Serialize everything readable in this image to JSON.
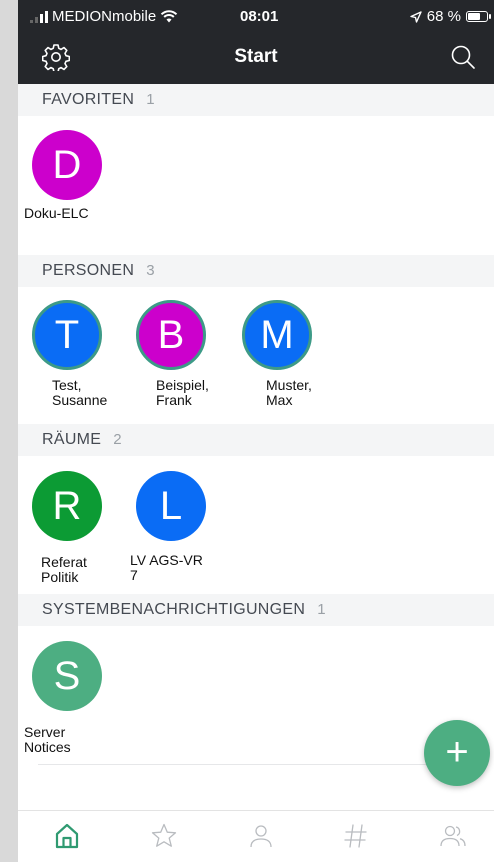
{
  "status": {
    "carrier": "MEDIONmobile",
    "time": "08:01",
    "battery": "68 %"
  },
  "nav": {
    "title": "Start",
    "left_icon": "gear-icon",
    "right_icon": "search-icon"
  },
  "sections": {
    "favorites": {
      "title": "FAVORITEN",
      "count": "1"
    },
    "people": {
      "title": "PERSONEN",
      "count": "3"
    },
    "rooms": {
      "title": "RÄUME",
      "count": "2"
    },
    "system": {
      "title": "SYSTEMBENACHRICHTIGUNGEN",
      "count": "1"
    }
  },
  "favorites": [
    {
      "initial": "D",
      "label": "Doku-ELC",
      "color": "#cc00cc"
    }
  ],
  "people": [
    {
      "initial": "T",
      "label": "Test,\nSusanne",
      "color": "#0a6cf5"
    },
    {
      "initial": "B",
      "label": "Beispiel,\nFrank",
      "color": "#cc00cc"
    },
    {
      "initial": "M",
      "label": "Muster,\nMax",
      "color": "#0a6cf5"
    }
  ],
  "rooms": [
    {
      "initial": "R",
      "label": "Referat\nPolitik",
      "color": "#0c9b34"
    },
    {
      "initial": "L",
      "label": "LV AGS-VR\n7",
      "color": "#0a6cf5"
    }
  ],
  "system": [
    {
      "initial": "S",
      "label": "Server\nNotices",
      "color": "#4dae82"
    }
  ],
  "fab": {
    "label": "+",
    "color": "#4dae82"
  },
  "tabs": [
    "home-icon",
    "star-icon",
    "person-icon",
    "hashtag-icon",
    "people-icon"
  ]
}
